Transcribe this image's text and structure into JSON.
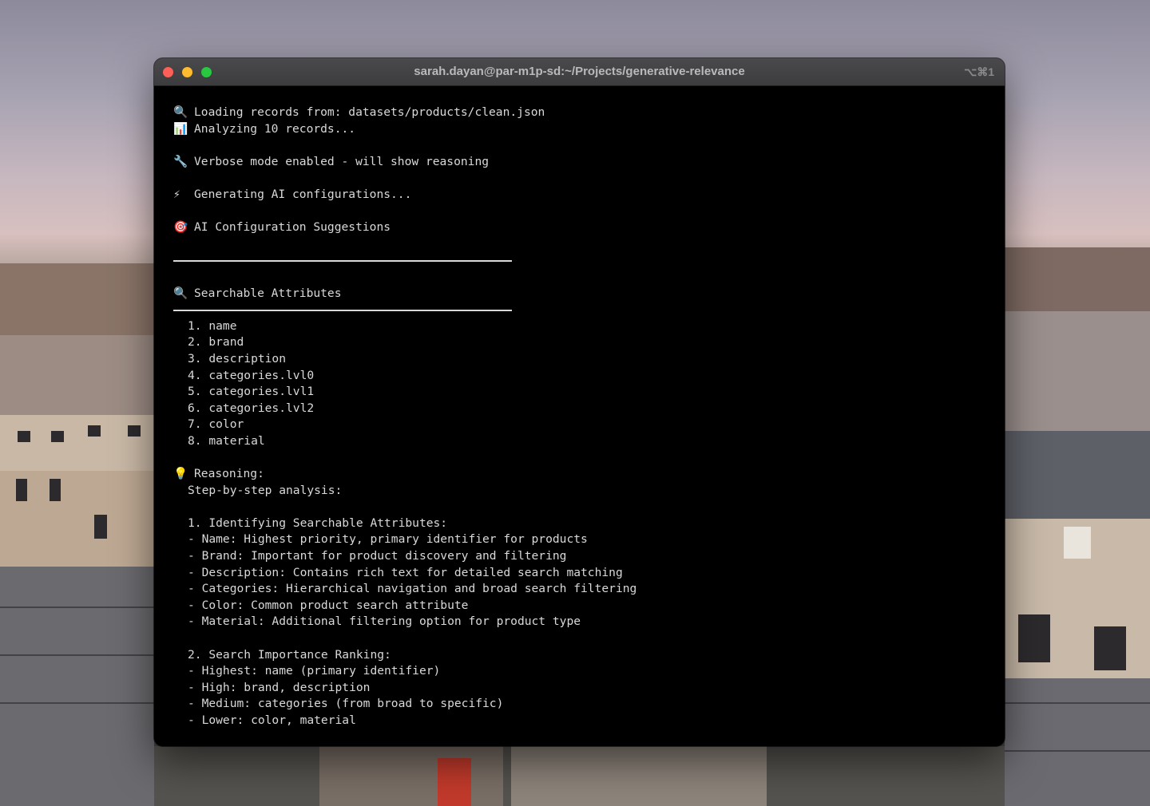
{
  "window": {
    "title": "sarah.dayan@par-m1p-sd:~/Projects/generative-relevance",
    "shortcut": "⌥⌘1"
  },
  "terminal": {
    "loading": {
      "icon": "🔍",
      "text": "Loading records from: datasets/products/clean.json"
    },
    "analyzing": {
      "icon": "📊",
      "text": "Analyzing 10 records..."
    },
    "verbose": {
      "icon": "🔧",
      "text": "Verbose mode enabled - will show reasoning"
    },
    "generating": {
      "icon": "⚡",
      "text": "Generating AI configurations..."
    },
    "suggestions": {
      "icon": "🎯",
      "text": "AI Configuration Suggestions"
    },
    "section_heading": {
      "icon": "🔍",
      "text": "Searchable Attributes"
    },
    "attributes": [
      "1. name",
      "2. brand",
      "3. description",
      "4. categories.lvl0",
      "5. categories.lvl1",
      "6. categories.lvl2",
      "7. color",
      "8. material"
    ],
    "reasoning_label": {
      "icon": "💡",
      "text": "Reasoning:"
    },
    "reasoning_lines": [
      "Step-by-step analysis:",
      "",
      "1. Identifying Searchable Attributes:",
      "- Name: Highest priority, primary identifier for products",
      "- Brand: Important for product discovery and filtering",
      "- Description: Contains rich text for detailed search matching",
      "- Categories: Hierarchical navigation and broad search filtering",
      "- Color: Common product search attribute",
      "- Material: Additional filtering option for product type",
      "",
      "2. Search Importance Ranking:",
      "- Highest: name (primary identifier)",
      "- High: brand, description",
      "- Medium: categories (from broad to specific)",
      "- Lower: color, material"
    ]
  }
}
